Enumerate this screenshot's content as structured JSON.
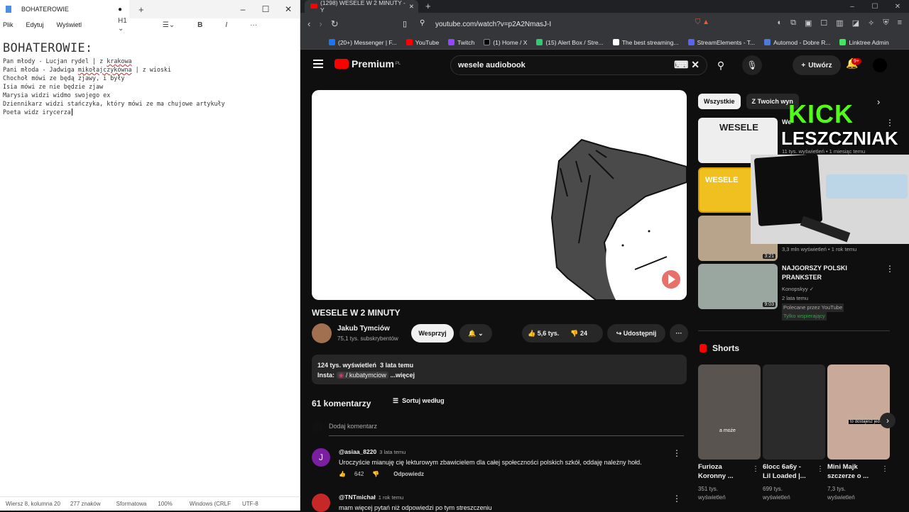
{
  "notepad": {
    "tab_title": "BOHATEROWIE",
    "menu": [
      "Plik",
      "Edytuj",
      "Wyświetl"
    ],
    "heading_style": "H1",
    "heading": "BOHATEROWIE:",
    "lines": [
      [
        "Pan młody - Lucjan rydel | z ",
        "krakowa",
        ""
      ],
      [
        "Pani młoda - Jadwiga ",
        "mikołajczykówna",
        " | z wioski"
      ],
      [
        "Chochoł mówi ze będą zjawy, i były",
        "",
        ""
      ],
      [
        "Isia mówi ze nie będzie zjaw",
        "",
        ""
      ],
      [
        "Marysia widzi widmo swojego ex",
        "",
        ""
      ],
      [
        "Dziennikarz widzi stańczyka, który mówi ze ma chujowe artykuły",
        "",
        ""
      ],
      [
        "Poeta widz irycerza",
        "",
        ""
      ]
    ],
    "status": {
      "position": "Wiersz 8, kolumna 20",
      "chars": "277 znaków",
      "format": "Sformatowa",
      "zoom": "100%",
      "eol": "Windows (CRLF",
      "encoding": "UTF-8"
    }
  },
  "browser": {
    "tab_title": "(1298) WESELE W 2 MINUTY - Y",
    "url": "youtube.com/watch?v=p2A2NmasJ-I",
    "bookmarks": [
      {
        "label": "(20+) Messenger | F...",
        "color": "#1877f2"
      },
      {
        "label": "YouTube",
        "color": "#f00"
      },
      {
        "label": "Twitch",
        "color": "#9146ff"
      },
      {
        "label": "(1) Home / X",
        "color": "#000"
      },
      {
        "label": "(15) Alert Box / Stre...",
        "color": "#2ecc71"
      },
      {
        "label": "The best streaming...",
        "color": "#fff"
      },
      {
        "label": "StreamElements - T...",
        "color": "#5865f2"
      },
      {
        "label": "Automod - Dobre R...",
        "color": "#4a7bd8"
      },
      {
        "label": "Linktree Admin",
        "color": "#43e660"
      }
    ]
  },
  "youtube": {
    "logo": "Premium",
    "logo_region": "PL",
    "search_value": "wesele audiobook",
    "create_label": "Utwórz",
    "notif_count": "9+",
    "video_title": "WESELE W 2 MINUTY",
    "channel": "Jakub Tymciów",
    "subs": "75,1 tys. subskrybentów",
    "support": "Wesprzyj",
    "likes": "5,6 tys.",
    "dislikes": "24",
    "share": "Udostępnij",
    "views": "124 tys. wyświetleń",
    "age": "3 lata temu",
    "desc_prefix": "Insta:",
    "desc_handle": "/ kubatymciow",
    "desc_more": "...więcej",
    "comments_count": "61 komentarzy",
    "sort_label": "Sortuj według",
    "add_comment": "Dodaj komentarz",
    "comments": [
      {
        "initial": "J",
        "avatar_color": "#7b1fa2",
        "author": "@asiaa_8220",
        "time": "3 lata temu",
        "text": "Uroczyście mianuję cię lekturowym zbawicielem dla całej społeczności polskich szkół, oddaję należny hołd.",
        "likes": "642",
        "reply": "Odpowiedz"
      },
      {
        "initial": "",
        "avatar_color": "#c62828",
        "author": "@TNTmichał",
        "time": "1 rok temu",
        "text": "mam więcej pytań niż odpowiedzi po tym streszczeniu",
        "likes": "",
        "reply": ""
      }
    ],
    "chips": [
      "Wszystkie",
      "Z Twoich wyn"
    ],
    "overlay_kick": "KICK",
    "overlay_name": "LESZCZNIAK",
    "recs": [
      {
        "title": "We",
        "meta1": "11 tys. wyświetleń • 1 miesiąc temu",
        "meta2": "",
        "duration": "",
        "thumb_text": "WESELE"
      },
      {
        "title": "",
        "meta1": "",
        "meta2": "",
        "duration": "",
        "thumb_text": "WESELE"
      },
      {
        "title": "",
        "meta1": "3,3 mln wyświetleń • 1 rok temu",
        "meta2": "",
        "duration": "3:21",
        "thumb_text": ""
      },
      {
        "title": "NAJGORSZY POLSKI PRANKSTER",
        "meta1": "Konopskyy ✓",
        "meta2": "2 lata temu",
        "duration": "9:03",
        "thumb_text": "",
        "badge1": "Polecane przez YouTube",
        "badge2": "Tylko wspierający"
      }
    ],
    "shorts_title": "Shorts",
    "shorts": [
      {
        "title": "Furioza",
        "title2": "Koronny ...",
        "views": "351 tys.",
        "views2": "wyświetleń",
        "caption": "a może"
      },
      {
        "title": "6locc 6a6y -",
        "title2": "Lil Loaded |...",
        "views": "699 tys.",
        "views2": "wyświetleń",
        "caption": ""
      },
      {
        "title": "Mini Majk",
        "title2": "szczerze o ...",
        "views": "7,3 tys.",
        "views2": "wyświetleń",
        "caption": "to dostajesz jeden"
      }
    ]
  }
}
